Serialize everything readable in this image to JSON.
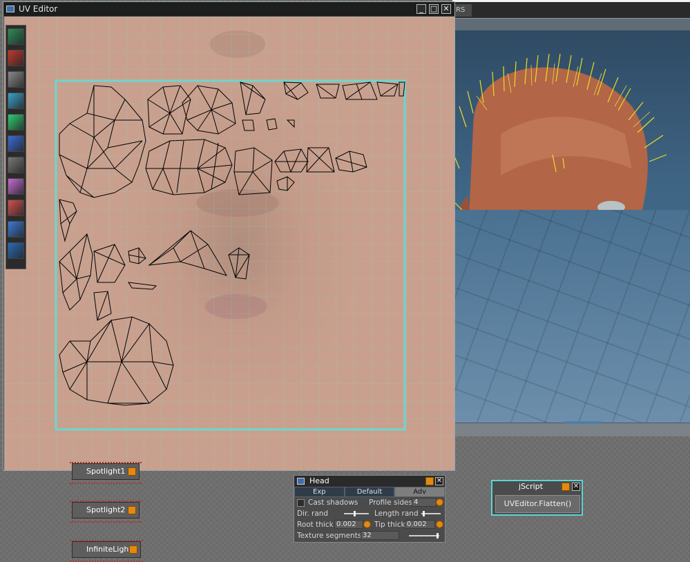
{
  "uv_editor": {
    "title": "UV Editor",
    "buttons": {
      "minimize": "_",
      "maximize": "□",
      "close": "✕"
    }
  },
  "topstrip": {
    "tab_fragment": "RS"
  },
  "tools": [
    {
      "icon": "select-tool-icon",
      "color": "#2e8b57"
    },
    {
      "icon": "move-tool-icon",
      "color": "#c0392b"
    },
    {
      "icon": "sphere-tool-icon",
      "color": "#888888"
    },
    {
      "icon": "pen-tool-icon",
      "color": "#3aa0c8"
    },
    {
      "icon": "relax-tool-icon",
      "color": "#2ecc71"
    },
    {
      "icon": "checker-tool-icon",
      "color": "#3a6bd6"
    },
    {
      "icon": "pin-tool-icon",
      "color": "#777777"
    },
    {
      "icon": "texture-tool-icon",
      "color": "#c46bd0"
    },
    {
      "icon": "grid-tool-icon",
      "color": "#d05050"
    },
    {
      "icon": "arrow-tool-icon",
      "color": "#3a7bd5"
    },
    {
      "icon": "undo-tool-icon",
      "color": "#2a6bb5"
    }
  ],
  "nodes": {
    "spotlight1": "Spotlight1",
    "spotlight2": "Spotlight2",
    "infinite_light": "InfiniteLight"
  },
  "head_panel": {
    "title": "Head",
    "tabs": [
      "Exp",
      "Default",
      "Adv"
    ],
    "active_tab": "Adv",
    "cast_shadows": "Cast shadows",
    "profile_sides_label": "Profile sides",
    "profile_sides_value": "4",
    "dir_rand_label": "Dir. rand",
    "length_rand_label": "Length rand",
    "root_thick_label": "Root thick",
    "root_thick_value": "0.002",
    "tip_thick_label": "Tip thick",
    "tip_thick_value": "0.002",
    "texture_segments_label": "Texture segments",
    "texture_segments_value": "32"
  },
  "jscript_node": {
    "title": "jScript",
    "button": "UVEditor.Flatten()"
  },
  "colors": {
    "accent_orange": "#e08a14",
    "uv_boundary": "#6ad8d0",
    "jscript_border": "#5ad6d6"
  }
}
